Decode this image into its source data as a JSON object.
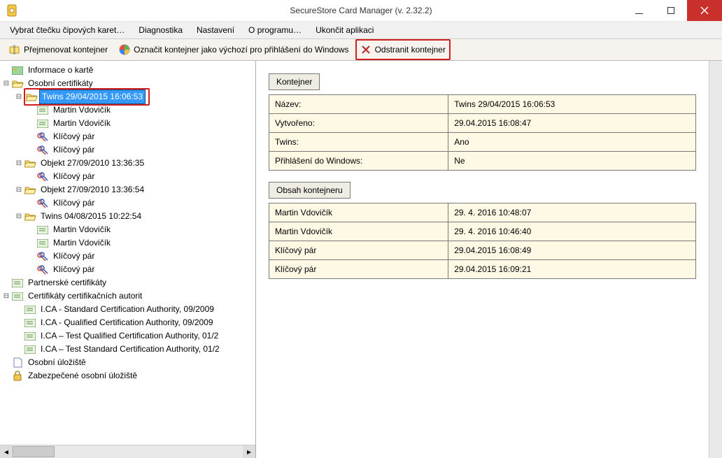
{
  "window": {
    "title": "SecureStore Card Manager (v. 2.32.2)"
  },
  "menu": {
    "reader": "Vybrat čtečku čipových karet…",
    "diagnostics": "Diagnostika",
    "settings": "Nastavení",
    "about": "O programu…",
    "exit": "Ukončit aplikaci"
  },
  "toolbar": {
    "rename": "Přejmenovat kontejner",
    "default_login": "Označit kontejner jako výchozí pro přihlášení do Windows",
    "delete": "Odstranit kontejner"
  },
  "tree": {
    "card_info": "Informace o kartě",
    "pers_certs": "Osobní certifikáty",
    "twins1": "Twins 29/04/2015 16:06:53",
    "mv": "Martin Vdovičík",
    "keypair": "Klíčový pár",
    "obj1": "Objekt 27/09/2010 13:36:35",
    "obj2": "Objekt 27/09/2010 13:36:54",
    "twins2": "Twins 04/08/2015 10:22:54",
    "partner": "Partnerské certifikáty",
    "ca_root": "Certifikáty certifikačních autorit",
    "ca1": "I.CA - Standard Certification Authority, 09/2009",
    "ca2": "I.CA - Qualified Certification Authority, 09/2009",
    "ca3": "I.CA – Test Qualified Certification Authority, 01/2",
    "ca4": "I.CA – Test Standard Certification Authority, 01/2",
    "store": "Osobní úložiště",
    "secure_store": "Zabezpečené osobní úložiště"
  },
  "detail": {
    "header1": "Kontejner",
    "rows1": [
      {
        "k": "Název:",
        "v": "Twins 29/04/2015 16:06:53"
      },
      {
        "k": "Vytvořeno:",
        "v": "29.04.2015 16:08:47"
      },
      {
        "k": "Twins:",
        "v": "Ano"
      },
      {
        "k": "Přihlášení do Windows:",
        "v": "Ne"
      }
    ],
    "header2": "Obsah kontejneru",
    "rows2": [
      {
        "k": "Martin Vdovičík",
        "v": "29. 4. 2016 10:48:07"
      },
      {
        "k": "Martin Vdovičík",
        "v": "29. 4. 2016 10:46:40"
      },
      {
        "k": "Klíčový pár",
        "v": "29.04.2015 16:08:49"
      },
      {
        "k": "Klíčový pár",
        "v": "29.04.2015 16:09:21"
      }
    ]
  }
}
